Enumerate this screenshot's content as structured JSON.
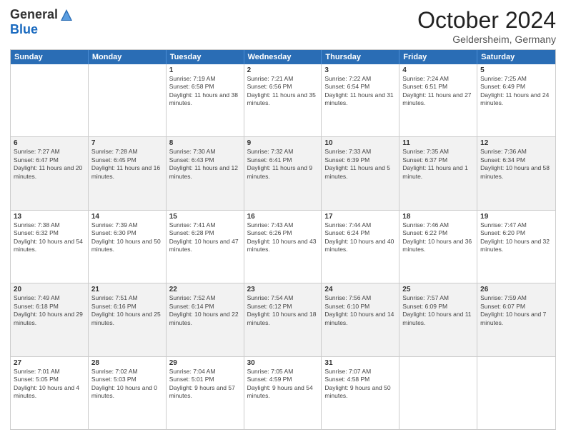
{
  "header": {
    "logo_general": "General",
    "logo_blue": "Blue",
    "month": "October 2024",
    "location": "Geldersheim, Germany"
  },
  "days_of_week": [
    "Sunday",
    "Monday",
    "Tuesday",
    "Wednesday",
    "Thursday",
    "Friday",
    "Saturday"
  ],
  "rows": [
    {
      "alt": false,
      "cells": [
        {
          "day": "",
          "sunrise": "",
          "sunset": "",
          "daylight": ""
        },
        {
          "day": "",
          "sunrise": "",
          "sunset": "",
          "daylight": ""
        },
        {
          "day": "1",
          "sunrise": "Sunrise: 7:19 AM",
          "sunset": "Sunset: 6:58 PM",
          "daylight": "Daylight: 11 hours and 38 minutes."
        },
        {
          "day": "2",
          "sunrise": "Sunrise: 7:21 AM",
          "sunset": "Sunset: 6:56 PM",
          "daylight": "Daylight: 11 hours and 35 minutes."
        },
        {
          "day": "3",
          "sunrise": "Sunrise: 7:22 AM",
          "sunset": "Sunset: 6:54 PM",
          "daylight": "Daylight: 11 hours and 31 minutes."
        },
        {
          "day": "4",
          "sunrise": "Sunrise: 7:24 AM",
          "sunset": "Sunset: 6:51 PM",
          "daylight": "Daylight: 11 hours and 27 minutes."
        },
        {
          "day": "5",
          "sunrise": "Sunrise: 7:25 AM",
          "sunset": "Sunset: 6:49 PM",
          "daylight": "Daylight: 11 hours and 24 minutes."
        }
      ]
    },
    {
      "alt": true,
      "cells": [
        {
          "day": "6",
          "sunrise": "Sunrise: 7:27 AM",
          "sunset": "Sunset: 6:47 PM",
          "daylight": "Daylight: 11 hours and 20 minutes."
        },
        {
          "day": "7",
          "sunrise": "Sunrise: 7:28 AM",
          "sunset": "Sunset: 6:45 PM",
          "daylight": "Daylight: 11 hours and 16 minutes."
        },
        {
          "day": "8",
          "sunrise": "Sunrise: 7:30 AM",
          "sunset": "Sunset: 6:43 PM",
          "daylight": "Daylight: 11 hours and 12 minutes."
        },
        {
          "day": "9",
          "sunrise": "Sunrise: 7:32 AM",
          "sunset": "Sunset: 6:41 PM",
          "daylight": "Daylight: 11 hours and 9 minutes."
        },
        {
          "day": "10",
          "sunrise": "Sunrise: 7:33 AM",
          "sunset": "Sunset: 6:39 PM",
          "daylight": "Daylight: 11 hours and 5 minutes."
        },
        {
          "day": "11",
          "sunrise": "Sunrise: 7:35 AM",
          "sunset": "Sunset: 6:37 PM",
          "daylight": "Daylight: 11 hours and 1 minute."
        },
        {
          "day": "12",
          "sunrise": "Sunrise: 7:36 AM",
          "sunset": "Sunset: 6:34 PM",
          "daylight": "Daylight: 10 hours and 58 minutes."
        }
      ]
    },
    {
      "alt": false,
      "cells": [
        {
          "day": "13",
          "sunrise": "Sunrise: 7:38 AM",
          "sunset": "Sunset: 6:32 PM",
          "daylight": "Daylight: 10 hours and 54 minutes."
        },
        {
          "day": "14",
          "sunrise": "Sunrise: 7:39 AM",
          "sunset": "Sunset: 6:30 PM",
          "daylight": "Daylight: 10 hours and 50 minutes."
        },
        {
          "day": "15",
          "sunrise": "Sunrise: 7:41 AM",
          "sunset": "Sunset: 6:28 PM",
          "daylight": "Daylight: 10 hours and 47 minutes."
        },
        {
          "day": "16",
          "sunrise": "Sunrise: 7:43 AM",
          "sunset": "Sunset: 6:26 PM",
          "daylight": "Daylight: 10 hours and 43 minutes."
        },
        {
          "day": "17",
          "sunrise": "Sunrise: 7:44 AM",
          "sunset": "Sunset: 6:24 PM",
          "daylight": "Daylight: 10 hours and 40 minutes."
        },
        {
          "day": "18",
          "sunrise": "Sunrise: 7:46 AM",
          "sunset": "Sunset: 6:22 PM",
          "daylight": "Daylight: 10 hours and 36 minutes."
        },
        {
          "day": "19",
          "sunrise": "Sunrise: 7:47 AM",
          "sunset": "Sunset: 6:20 PM",
          "daylight": "Daylight: 10 hours and 32 minutes."
        }
      ]
    },
    {
      "alt": true,
      "cells": [
        {
          "day": "20",
          "sunrise": "Sunrise: 7:49 AM",
          "sunset": "Sunset: 6:18 PM",
          "daylight": "Daylight: 10 hours and 29 minutes."
        },
        {
          "day": "21",
          "sunrise": "Sunrise: 7:51 AM",
          "sunset": "Sunset: 6:16 PM",
          "daylight": "Daylight: 10 hours and 25 minutes."
        },
        {
          "day": "22",
          "sunrise": "Sunrise: 7:52 AM",
          "sunset": "Sunset: 6:14 PM",
          "daylight": "Daylight: 10 hours and 22 minutes."
        },
        {
          "day": "23",
          "sunrise": "Sunrise: 7:54 AM",
          "sunset": "Sunset: 6:12 PM",
          "daylight": "Daylight: 10 hours and 18 minutes."
        },
        {
          "day": "24",
          "sunrise": "Sunrise: 7:56 AM",
          "sunset": "Sunset: 6:10 PM",
          "daylight": "Daylight: 10 hours and 14 minutes."
        },
        {
          "day": "25",
          "sunrise": "Sunrise: 7:57 AM",
          "sunset": "Sunset: 6:09 PM",
          "daylight": "Daylight: 10 hours and 11 minutes."
        },
        {
          "day": "26",
          "sunrise": "Sunrise: 7:59 AM",
          "sunset": "Sunset: 6:07 PM",
          "daylight": "Daylight: 10 hours and 7 minutes."
        }
      ]
    },
    {
      "alt": false,
      "cells": [
        {
          "day": "27",
          "sunrise": "Sunrise: 7:01 AM",
          "sunset": "Sunset: 5:05 PM",
          "daylight": "Daylight: 10 hours and 4 minutes."
        },
        {
          "day": "28",
          "sunrise": "Sunrise: 7:02 AM",
          "sunset": "Sunset: 5:03 PM",
          "daylight": "Daylight: 10 hours and 0 minutes."
        },
        {
          "day": "29",
          "sunrise": "Sunrise: 7:04 AM",
          "sunset": "Sunset: 5:01 PM",
          "daylight": "Daylight: 9 hours and 57 minutes."
        },
        {
          "day": "30",
          "sunrise": "Sunrise: 7:05 AM",
          "sunset": "Sunset: 4:59 PM",
          "daylight": "Daylight: 9 hours and 54 minutes."
        },
        {
          "day": "31",
          "sunrise": "Sunrise: 7:07 AM",
          "sunset": "Sunset: 4:58 PM",
          "daylight": "Daylight: 9 hours and 50 minutes."
        },
        {
          "day": "",
          "sunrise": "",
          "sunset": "",
          "daylight": ""
        },
        {
          "day": "",
          "sunrise": "",
          "sunset": "",
          "daylight": ""
        }
      ]
    }
  ]
}
